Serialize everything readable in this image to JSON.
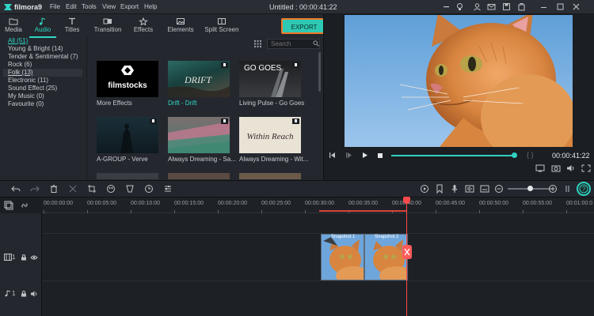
{
  "app": {
    "name": "filmora9",
    "window_title": "Untitled : 00:00:41:22"
  },
  "menu": [
    "File",
    "Edit",
    "Tools",
    "View",
    "Export",
    "Help"
  ],
  "window_controls": [
    "minimize-icon",
    "restore-icon",
    "save-icon",
    "account-icon",
    "mail-icon",
    "minimize-icon",
    "maximize-icon",
    "close-icon"
  ],
  "tabs": [
    {
      "label": "Media",
      "icon": "folder-icon"
    },
    {
      "label": "Audio",
      "icon": "music-note-icon"
    },
    {
      "label": "Titles",
      "icon": "text-icon"
    },
    {
      "label": "Transition",
      "icon": "transition-icon"
    },
    {
      "label": "Effects",
      "icon": "effects-icon"
    },
    {
      "label": "Elements",
      "icon": "image-icon"
    },
    {
      "label": "Split Screen",
      "icon": "split-screen-icon"
    }
  ],
  "active_tab": "Audio",
  "export_label": "EXPORT",
  "categories": [
    "All (51)",
    "Young & Bright (14)",
    "Tender & Sentimental (7)",
    "Rock (6)",
    "Folk (13)",
    "Electronic (11)",
    "Sound Effect (25)",
    "My Music (0)",
    "Favourite (0)"
  ],
  "search": {
    "placeholder": "Search"
  },
  "thumbs": [
    {
      "label": "More Effects",
      "overlay": "filmstocks"
    },
    {
      "label": "Drift - Drift",
      "overlay": "DRIFT"
    },
    {
      "label": "Living Pulse - Go Goes",
      "overlay": "GO GOES"
    },
    {
      "label": "A-GROUP - Verve",
      "overlay": ""
    },
    {
      "label": "Always Dreaming - Sa...",
      "overlay": ""
    },
    {
      "label": "Always Dreaming - Wit...",
      "overlay": "Within Reach"
    }
  ],
  "preview": {
    "time": "00:00:41:22",
    "progress": 0.97
  },
  "timeline": {
    "ruler": [
      "00:00:00:00",
      "00:00:05:00",
      "00:00:10:00",
      "00:00:15:00",
      "00:00:20:00",
      "00:00:25:00",
      "00:00:30:00",
      "00:00:35:00",
      "00:00:40:00",
      "00:00:45:00",
      "00:00:50:00",
      "00:00:55:00",
      "00:01:00:0"
    ],
    "clips": [
      {
        "label": "Snapshot 1"
      },
      {
        "label": "Snapshot 2"
      }
    ]
  },
  "colors": {
    "accent": "#30d6c4",
    "export_border": "#f07a2a",
    "playhead": "#ff4a4a"
  }
}
